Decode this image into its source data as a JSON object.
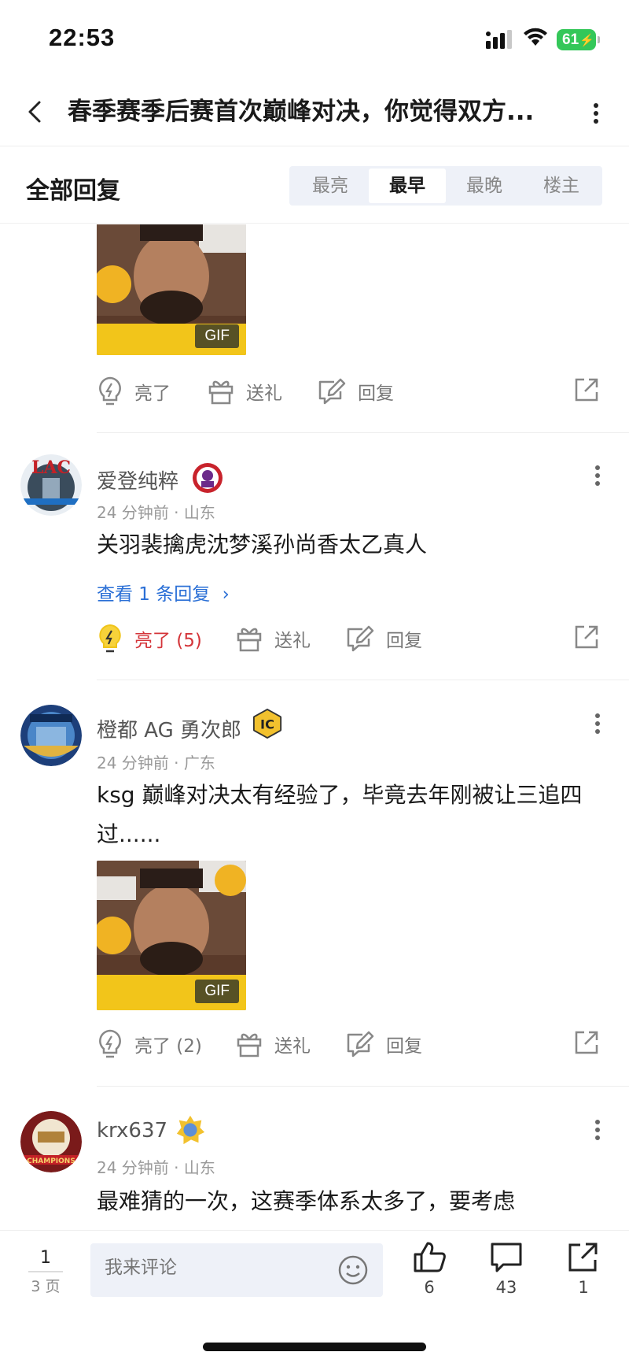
{
  "status_bar": {
    "time": "22:53",
    "battery": "61"
  },
  "nav": {
    "title": "春季赛季后赛首次巅峰对决，你觉得双方..."
  },
  "replies_header": {
    "title": "全部回复",
    "sort_tabs": [
      "最亮",
      "最早",
      "最晚",
      "楼主"
    ],
    "active_tab": "最早"
  },
  "top_reply": {
    "gif_label": "GIF",
    "actions": {
      "light": "亮了",
      "gift": "送礼",
      "reply": "回复"
    }
  },
  "comments": [
    {
      "username": "爱登纯粹",
      "meta": "24 分钟前 · 山东",
      "text": "关羽裴擒虎沈梦溪孙尚香太乙真人",
      "view_replies": "查看 1 条回复",
      "light": "亮了 (5)",
      "gift": "送礼",
      "reply": "回复"
    },
    {
      "username": "橙都 AG 勇次郎",
      "meta": "24 分钟前 · 广东",
      "text": "ksg 巅峰对决太有经验了，毕竟去年刚被让三追四过......",
      "gif_label": "GIF",
      "light": "亮了 (2)",
      "gift": "送礼",
      "reply": "回复"
    },
    {
      "username": "krx637",
      "meta": "24 分钟前 · 山东",
      "text": "最难猜的一次，这赛季体系太多了，要考虑"
    }
  ],
  "bottom_bar": {
    "page_current": "1",
    "page_total": "3 页",
    "comment_placeholder": "我来评论",
    "like_count": "6",
    "comment_count": "43",
    "share_count": "1"
  },
  "colors": {
    "accent_blue": "#2a6fd6",
    "lit_red": "#d4353a",
    "battery_green": "#34c759"
  }
}
